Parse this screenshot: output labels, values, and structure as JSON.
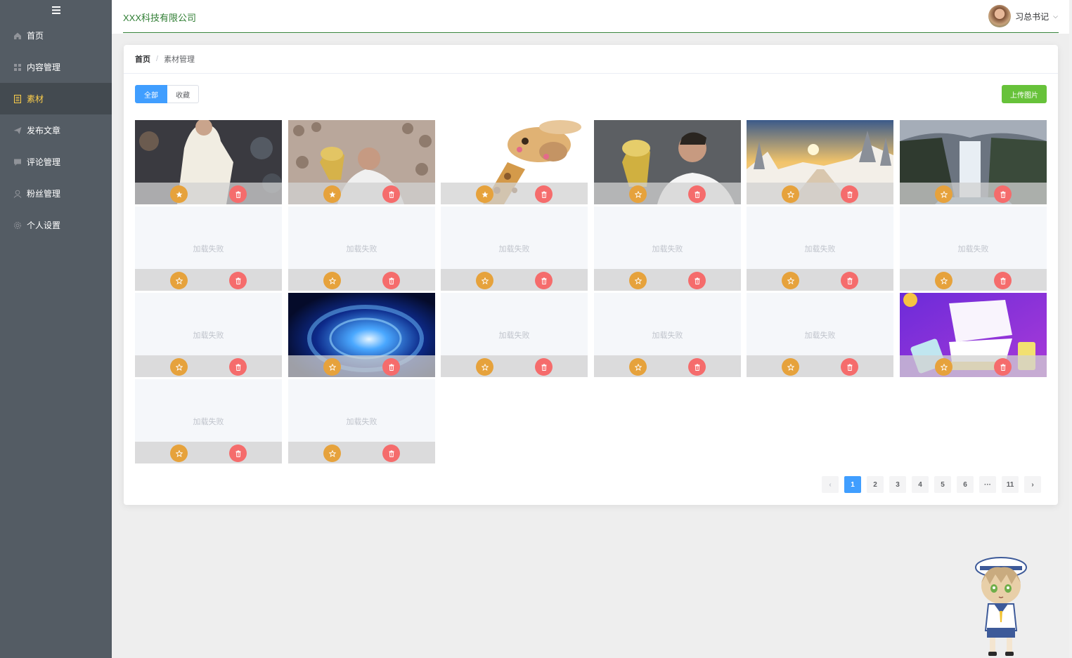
{
  "sidebar": {
    "items": [
      {
        "label": "首页",
        "icon": "home-icon"
      },
      {
        "label": "内容管理",
        "icon": "grid-icon"
      },
      {
        "label": "素材",
        "icon": "document-icon",
        "active": true
      },
      {
        "label": "发布文章",
        "icon": "send-icon"
      },
      {
        "label": "评论管理",
        "icon": "comment-icon"
      },
      {
        "label": "粉丝管理",
        "icon": "user-icon"
      },
      {
        "label": "个人设置",
        "icon": "setting-icon"
      }
    ]
  },
  "header": {
    "company": "XXX科技有限公司",
    "user_name": "习总书记",
    "caret": "⌵"
  },
  "breadcrumb": {
    "home": "首页",
    "separator": "/",
    "current": "素材管理"
  },
  "toolbar": {
    "tab_all": "全部",
    "tab_collect": "收藏",
    "upload": "上传图片"
  },
  "fail_text": "加载失败",
  "materials": [
    {
      "status": "loaded",
      "subject": "tennis player back view",
      "collected": true
    },
    {
      "status": "loaded",
      "subject": "player kissing trophy in crowd",
      "collected": true
    },
    {
      "status": "loaded",
      "subject": "giraffe",
      "collected": true
    },
    {
      "status": "loaded",
      "subject": "player kissing trophy",
      "collected": false
    },
    {
      "status": "loaded",
      "subject": "snowy forest sunrise",
      "collected": false
    },
    {
      "status": "loaded",
      "subject": "waterfall",
      "collected": false
    },
    {
      "status": "failed",
      "collected": false
    },
    {
      "status": "failed",
      "collected": false
    },
    {
      "status": "failed",
      "collected": false
    },
    {
      "status": "failed",
      "collected": false
    },
    {
      "status": "failed",
      "collected": false
    },
    {
      "status": "failed",
      "collected": false
    },
    {
      "status": "failed",
      "collected": false
    },
    {
      "status": "loaded",
      "subject": "blue galaxy",
      "collected": false
    },
    {
      "status": "failed",
      "collected": false
    },
    {
      "status": "failed",
      "collected": false
    },
    {
      "status": "failed",
      "collected": false
    },
    {
      "status": "loaded",
      "subject": "brand PK promotion banner",
      "collected": false
    },
    {
      "status": "failed",
      "collected": false
    },
    {
      "status": "failed",
      "collected": false
    }
  ],
  "pagination": {
    "prev": "‹",
    "pages": [
      "1",
      "2",
      "3",
      "4",
      "5",
      "6",
      "···",
      "11"
    ],
    "current": "1",
    "next": "›"
  },
  "colors": {
    "sidebar_bg": "#545c64",
    "sidebar_active_text": "#ffd04b",
    "primary": "#409eff",
    "success": "#67c23a",
    "warning": "#e6a23c",
    "danger": "#f56c6c",
    "brand_text": "#2e7d32"
  }
}
